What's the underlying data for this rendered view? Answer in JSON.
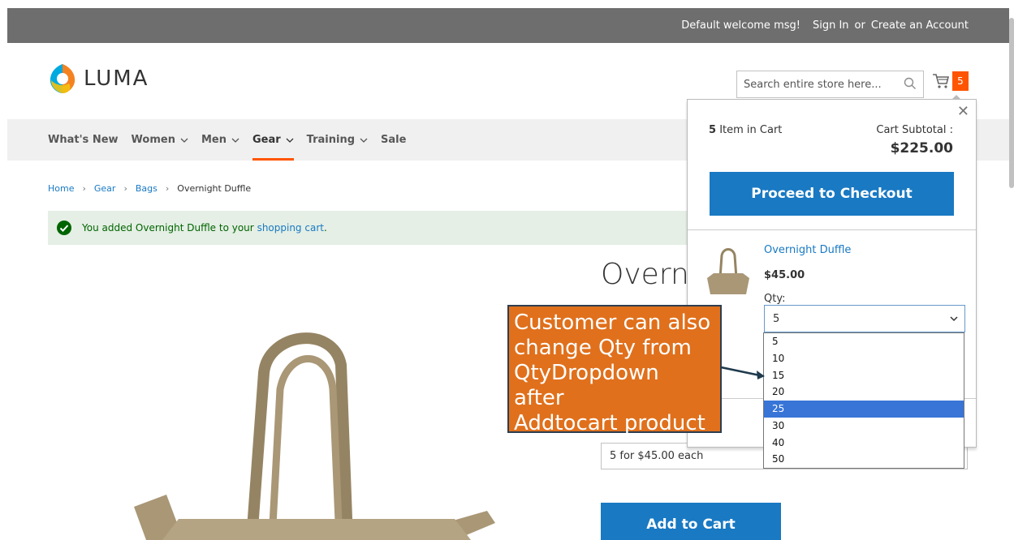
{
  "topbar": {
    "welcome": "Default welcome msg!",
    "sign_in": "Sign In",
    "or": "or",
    "create_account": "Create an Account"
  },
  "header": {
    "logo_text": "LUMA",
    "search_placeholder": "Search entire store here...",
    "cart_count": "5"
  },
  "nav": {
    "items": [
      {
        "label": "What's New",
        "has_dropdown": false
      },
      {
        "label": "Women",
        "has_dropdown": true
      },
      {
        "label": "Men",
        "has_dropdown": true
      },
      {
        "label": "Gear",
        "has_dropdown": true,
        "active": true
      },
      {
        "label": "Training",
        "has_dropdown": true
      },
      {
        "label": "Sale",
        "has_dropdown": false
      }
    ]
  },
  "breadcrumb": {
    "items": [
      "Home",
      "Gear",
      "Bags",
      "Overnight Duffle"
    ]
  },
  "message": {
    "prefix": "You added Overnight Duffle to your",
    "link": "shopping cart",
    "suffix": "."
  },
  "product": {
    "title_visible": "Overni",
    "price_option": "5 for $45.00 each",
    "add_to_cart": "Add to Cart"
  },
  "minicart": {
    "items_count_number": "5",
    "items_count_label": "Item in Cart",
    "subtotal_label": "Cart Subtotal :",
    "subtotal_value": "$225.00",
    "checkout_label": "Proceed to Checkout",
    "item": {
      "name": "Overnight Duffle",
      "price": "$45.00",
      "qty_label": "Qty:",
      "qty_value": "5"
    },
    "qty_options": [
      "5",
      "10",
      "15",
      "20",
      "25",
      "30",
      "40",
      "50"
    ],
    "qty_highlighted": "25"
  },
  "callout": {
    "lines": [
      "Customer can also",
      "change Qty from",
      "QtyDropdown after",
      "Addtocart product"
    ]
  },
  "colors": {
    "accent": "#1979c3",
    "brand_orange": "#ff5501",
    "callout": "#e0701c"
  }
}
